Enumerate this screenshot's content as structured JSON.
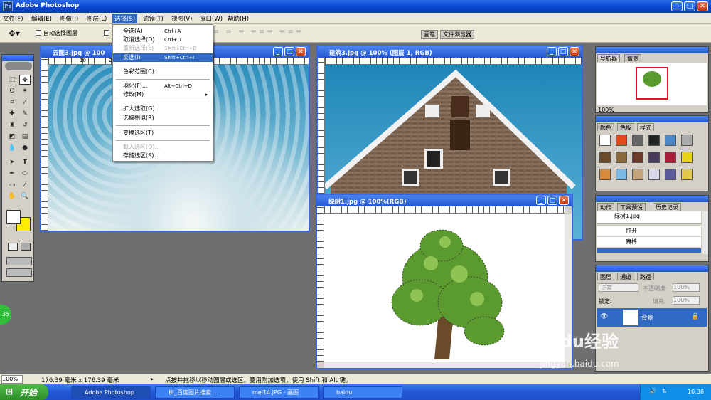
{
  "app": {
    "title": "Adobe Photoshop"
  },
  "menu": [
    "文件(F)",
    "编辑(E)",
    "图像(I)",
    "图层(L)",
    "选择(S)",
    "滤镜(T)",
    "视图(V)",
    "窗口(W)",
    "帮助(H)"
  ],
  "options": {
    "auto_select": "自动选择图层",
    "tab_brushes": "画笔",
    "tab_browser": "文件浏览器"
  },
  "select_menu": [
    {
      "label": "全选(A)",
      "shortcut": "Ctrl+A",
      "state": "normal"
    },
    {
      "label": "取消选择(D)",
      "shortcut": "Ctrl+D",
      "state": "normal"
    },
    {
      "label": "重新选择(E)",
      "shortcut": "Shift+Ctrl+D",
      "state": "disabled"
    },
    {
      "label": "反选(I)",
      "shortcut": "Shift+Ctrl+I",
      "state": "selected"
    },
    {
      "label": "色彩范围(C)...",
      "shortcut": "",
      "state": "normal"
    },
    {
      "label": "羽化(F)...",
      "shortcut": "Alt+Ctrl+D",
      "state": "normal"
    },
    {
      "label": "修改(M)",
      "shortcut": "▸",
      "state": "normal"
    },
    {
      "label": "扩大选取(G)",
      "shortcut": "",
      "state": "normal"
    },
    {
      "label": "选取相似(R)",
      "shortcut": "",
      "state": "normal"
    },
    {
      "label": "变换选区(T)",
      "shortcut": "",
      "state": "normal"
    },
    {
      "label": "载入选区(O)...",
      "shortcut": "",
      "state": "disabled"
    },
    {
      "label": "存储选区(S)...",
      "shortcut": "",
      "state": "normal"
    }
  ],
  "docs": {
    "clouds": {
      "title": "云图3.jpg @ 100"
    },
    "building": {
      "title": "建筑3.jpg @ 100% (图层 1, RGB)"
    },
    "tree": {
      "title": "绿树1.jpg @ 100%(RGB)"
    }
  },
  "rulers": {
    "a": [
      "10",
      "20",
      "30",
      "40",
      "50",
      "60",
      "70",
      "80",
      "90"
    ],
    "b": [
      "0",
      "10",
      "20",
      "30",
      "40",
      "50",
      "60",
      "70",
      "80",
      "90",
      "100",
      "110",
      "120",
      "130",
      "140",
      "150",
      "160"
    ]
  },
  "navigator": {
    "tab1": "导航器",
    "tab2": "信息",
    "zoom": "100%"
  },
  "styles_panel": {
    "tabs": [
      "颜色",
      "色板",
      "样式"
    ]
  },
  "history": {
    "tabs": [
      "动作",
      "工具预设",
      "历史记录"
    ],
    "snapshot": "绿树1.jpg",
    "items": [
      "打开",
      "魔棒"
    ]
  },
  "layers": {
    "tabs": [
      "图层",
      "通道",
      "路径"
    ],
    "mode": "正常",
    "opacity_label": "不透明度:",
    "opacity": "100%",
    "lock_label": "锁定:",
    "fill_label": "填充:",
    "fill": "100%",
    "layer_name": "背景"
  },
  "status": {
    "zoom": "100%",
    "size": "176.39 毫米 x 176.39 毫米",
    "hint": "点按并拖移以移动图层或选区。要用附加选项，使用 Shift 和 Alt 键。"
  },
  "taskbar": {
    "start": "开始",
    "tasks": [
      "Adobe Photoshop",
      "树_百度图片搜索 ...",
      "mei14.JPG - 画图",
      "baidu"
    ],
    "clock": "10:38"
  },
  "watermark": {
    "line1": "Baidu经验",
    "line2": "jingyan.baidu.com"
  },
  "badge": "35",
  "colors": {
    "xp_blue": "#2456cf",
    "menu_bg": "#ece9d8",
    "selected": "#316ac5",
    "fg_swatch": "#ffffff",
    "bg_swatch": "#ffee00"
  }
}
